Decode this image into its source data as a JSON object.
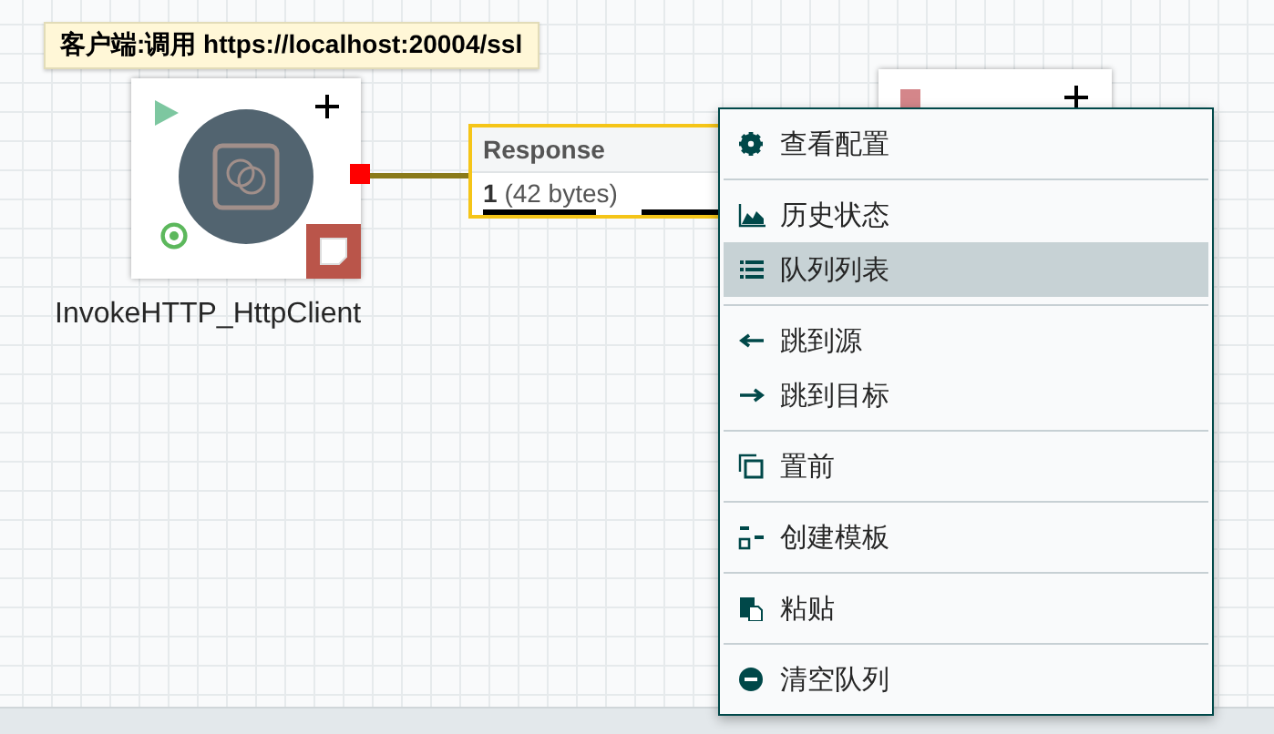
{
  "comment": {
    "text": "客户端:调用 https://localhost:20004/ssl"
  },
  "processor": {
    "name": "InvokeHTTP_HttpClient"
  },
  "connection": {
    "name": "Response",
    "queued_count": "1",
    "queued_size": "(42 bytes)"
  },
  "context_menu": {
    "groups": [
      [
        {
          "label": "查看配置",
          "selected": false
        }
      ],
      [
        {
          "label": "历史状态",
          "selected": false
        },
        {
          "label": "队列列表",
          "selected": true
        }
      ],
      [
        {
          "label": "跳到源",
          "selected": false
        },
        {
          "label": "跳到目标",
          "selected": false
        }
      ],
      [
        {
          "label": "置前",
          "selected": false
        }
      ],
      [
        {
          "label": "创建模板",
          "selected": false
        }
      ],
      [
        {
          "label": "粘贴",
          "selected": false
        }
      ],
      [
        {
          "label": "清空队列",
          "selected": false
        }
      ]
    ]
  }
}
